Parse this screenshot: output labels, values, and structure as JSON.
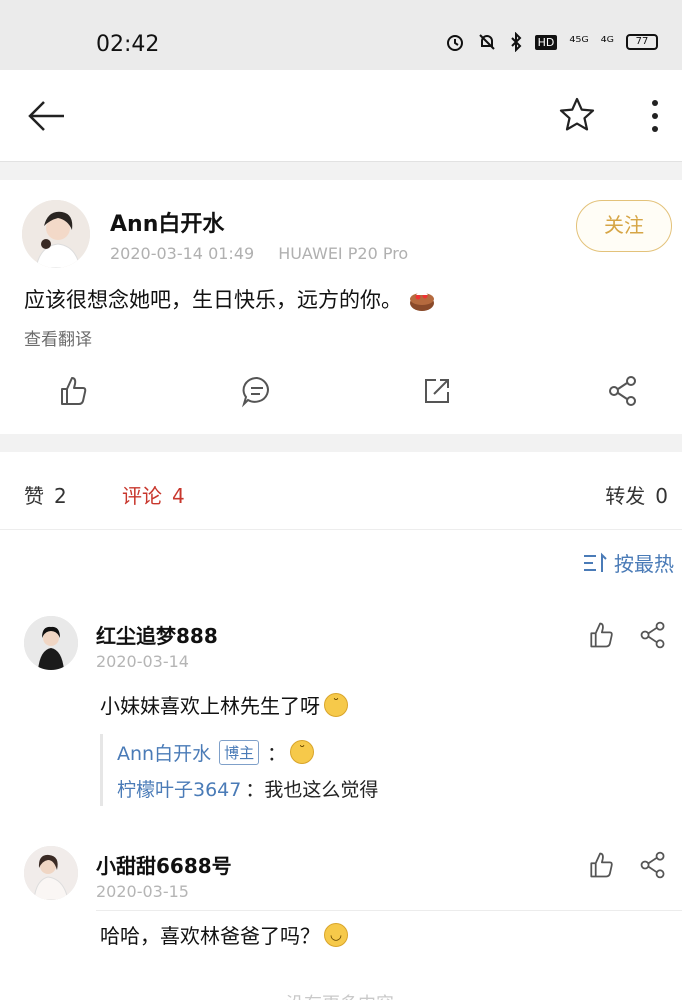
{
  "status_bar": {
    "time": "02:42",
    "net1": "⁴⁵ᴳ",
    "net2": "⁴ᴳ",
    "hd": "HD",
    "battery": "77"
  },
  "post": {
    "author": "Ann白开水",
    "date": "2020-03-14 01:49",
    "device": "HUAWEI P20 Pro",
    "follow_label": "关注",
    "content": "应该很想念她吧，生日快乐，远方的你。",
    "translate_label": "查看翻译"
  },
  "stats": {
    "like_label": "赞",
    "like_count": "2",
    "comment_label": "评论",
    "comment_count": "4",
    "forward_label": "转发",
    "forward_count": "0"
  },
  "sort_label": "按最热",
  "comments": [
    {
      "name": "红尘追梦888",
      "date": "2020-03-14",
      "text": "小妹妹喜欢上林先生了呀",
      "replies": [
        {
          "name": "Ann白开水",
          "badge": "博主",
          "text": "："
        },
        {
          "name": "柠檬叶子3647",
          "text": "：我也这么觉得"
        }
      ]
    },
    {
      "name": "小甜甜6688号",
      "date": "2020-03-15",
      "text": "哈哈，喜欢林爸爸了吗？"
    }
  ],
  "bottom_hint": "没有更多内容"
}
